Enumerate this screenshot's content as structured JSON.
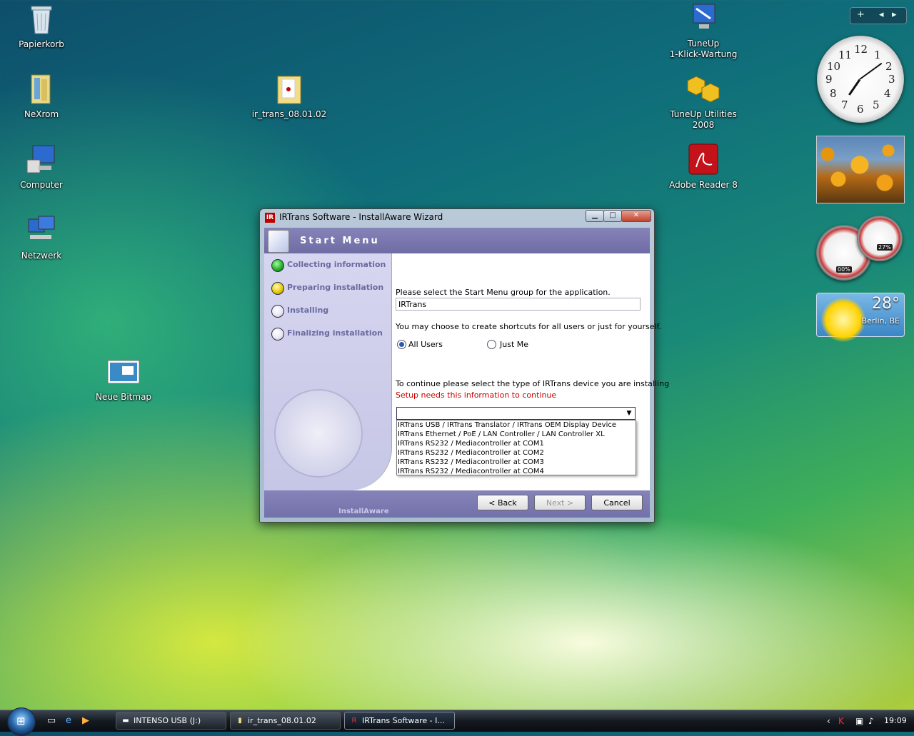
{
  "desktop": {
    "icons": [
      {
        "label": "Papierkorb",
        "icon": "recycle-bin-icon"
      },
      {
        "label": "NeXrom",
        "icon": "folder-icon"
      },
      {
        "label": "Computer",
        "icon": "computer-icon"
      },
      {
        "label": "Netzwerk",
        "icon": "network-icon"
      },
      {
        "label": "ir_trans_08.01.02",
        "icon": "folder-icon"
      },
      {
        "label": "Neue Bitmap",
        "icon": "bitmap-icon"
      },
      {
        "label": "TuneUp\n1-Klick-Wartung",
        "icon": "tuneup-icon"
      },
      {
        "label": "TuneUp Utilities 2008",
        "icon": "tuneup-utilities-icon"
      },
      {
        "label": "Adobe Reader 8",
        "icon": "adobe-reader-icon"
      }
    ]
  },
  "sidebar": {
    "controls": [
      "+",
      "◂",
      "▸"
    ],
    "clock": {
      "numbers": [
        "12",
        "1",
        "2",
        "3",
        "4",
        "5",
        "6",
        "7",
        "8",
        "9",
        "10",
        "11"
      ],
      "hour": 7,
      "minute": 9
    },
    "cpu_meter": {
      "cpu": "00%",
      "memory": "27%"
    },
    "weather": {
      "temperature": "28°",
      "city": "Berlin, BE"
    }
  },
  "wizard": {
    "title": "IRTrans Software - InstallAware Wizard",
    "app_icon": "IR",
    "caption_buttons": {
      "minimize": "▁",
      "maximize": "□",
      "close": "✕"
    },
    "header_title": "Start Menu",
    "steps": [
      {
        "label": "Collecting information",
        "color": "#22aa22"
      },
      {
        "label": "Preparing installation",
        "color": "#e5c400"
      },
      {
        "label": "Installing",
        "color": "#ffffff"
      },
      {
        "label": "Finalizing installation",
        "color": "#ffffff"
      }
    ],
    "prompt_group": "Please select the Start Menu group for the application.",
    "group_value": "IRTrans",
    "prompt_users": "You may choose to create shortcuts for all users or just for yourself.",
    "radio_all_users": "All Users",
    "radio_just_me": "Just Me",
    "prompt_device": "To continue please select the type of IRTrans device you are installing",
    "warning": "Setup needs this information to continue",
    "device_options": [
      "IRTrans USB / IRTrans Translator / IRTrans OEM Display Device",
      "IRTrans Ethernet / PoE / LAN Controller / LAN Controller XL",
      "IRTrans RS232 / Mediacontroller at COM1",
      "IRTrans RS232 / Mediacontroller at COM2",
      "IRTrans RS232 / Mediacontroller at COM3",
      "IRTrans RS232 / Mediacontroller at COM4"
    ],
    "brand": "InstallAware",
    "back_label": "< Back",
    "next_label": "Next >",
    "cancel_label": "Cancel"
  },
  "taskbar": {
    "tasks": [
      {
        "label": "INTENSO USB (J:)",
        "icon": "drive-icon"
      },
      {
        "label": "ir_trans_08.01.02",
        "icon": "folder-icon"
      },
      {
        "label": "IRTrans Software - I...",
        "icon": "irtrans-icon"
      }
    ],
    "time": "19:09"
  }
}
